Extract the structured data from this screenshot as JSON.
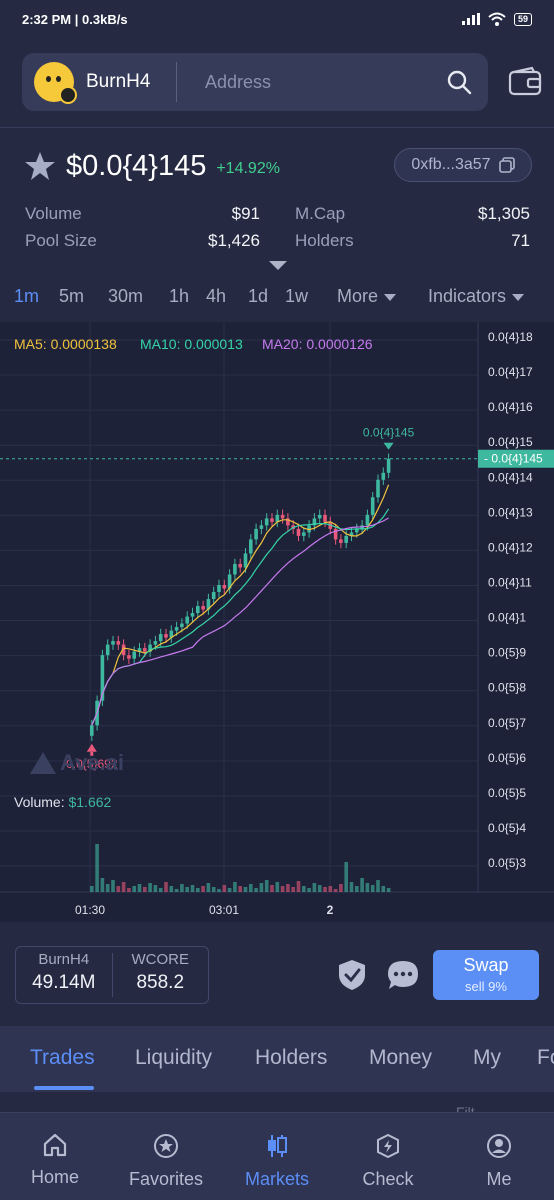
{
  "status": {
    "time": "2:32 PM",
    "speed": "0.3kB/s",
    "battery": "59"
  },
  "header": {
    "token_name": "BurnH4",
    "address_placeholder": "Address"
  },
  "token": {
    "price": "$0.0{4}145",
    "change": "+14.92%",
    "contract": "0xfb...3a57"
  },
  "stats": {
    "volume_label": "Volume",
    "volume_value": "$91",
    "mcap_label": "M.Cap",
    "mcap_value": "$1,305",
    "pool_label": "Pool Size",
    "pool_value": "$1,426",
    "holders_label": "Holders",
    "holders_value": "71"
  },
  "intervals": {
    "i1m": "1m",
    "i5m": "5m",
    "i30m": "30m",
    "i1h": "1h",
    "i4h": "4h",
    "i1d": "1d",
    "i1w": "1w",
    "more": "More",
    "indicators": "Indicators"
  },
  "chart": {
    "ma5": "MA5: 0.0000138",
    "ma10": "MA10: 0.000013",
    "ma20": "MA20: 0.0000126",
    "y_ticks": [
      "0.0{4}18",
      "0.0{4}17",
      "0.0{4}16",
      "0.0{4}15",
      "0.0{4}14",
      "0.0{4}13",
      "0.0{4}12",
      "0.0{4}11",
      "0.0{4}1",
      "0.0{5}9",
      "0.0{5}8",
      "0.0{5}7",
      "0.0{5}6",
      "0.0{5}5",
      "0.0{5}4",
      "0.0{5}3"
    ],
    "x_ticks": [
      "01:30",
      "03:01",
      "2"
    ],
    "current_label": "0.0{4}145",
    "high_label": "0.0{4}145",
    "low_label": "0.0{5}692",
    "volume_label": "Volume: ",
    "volume_value": "$1.662",
    "watermark": "Ave.ai",
    "colors": {
      "up": "#3fb8a0",
      "down": "#e8587a",
      "ma5": "#f0c23c",
      "ma10": "#35d4a8",
      "ma20": "#c77af0"
    }
  },
  "reserve": {
    "token_a": "BurnH4",
    "amount_a": "49.14M",
    "token_b": "WCORE",
    "amount_b": "858.2"
  },
  "swap": {
    "label": "Swap",
    "sub": "sell 9%"
  },
  "tabs": [
    "Trades",
    "Liquidity",
    "Holders",
    "Money",
    "My",
    "Fo"
  ],
  "filter_peek": "Filt",
  "nav": {
    "home": "Home",
    "favorites": "Favorites",
    "markets": "Markets",
    "check": "Check",
    "me": "Me"
  }
}
